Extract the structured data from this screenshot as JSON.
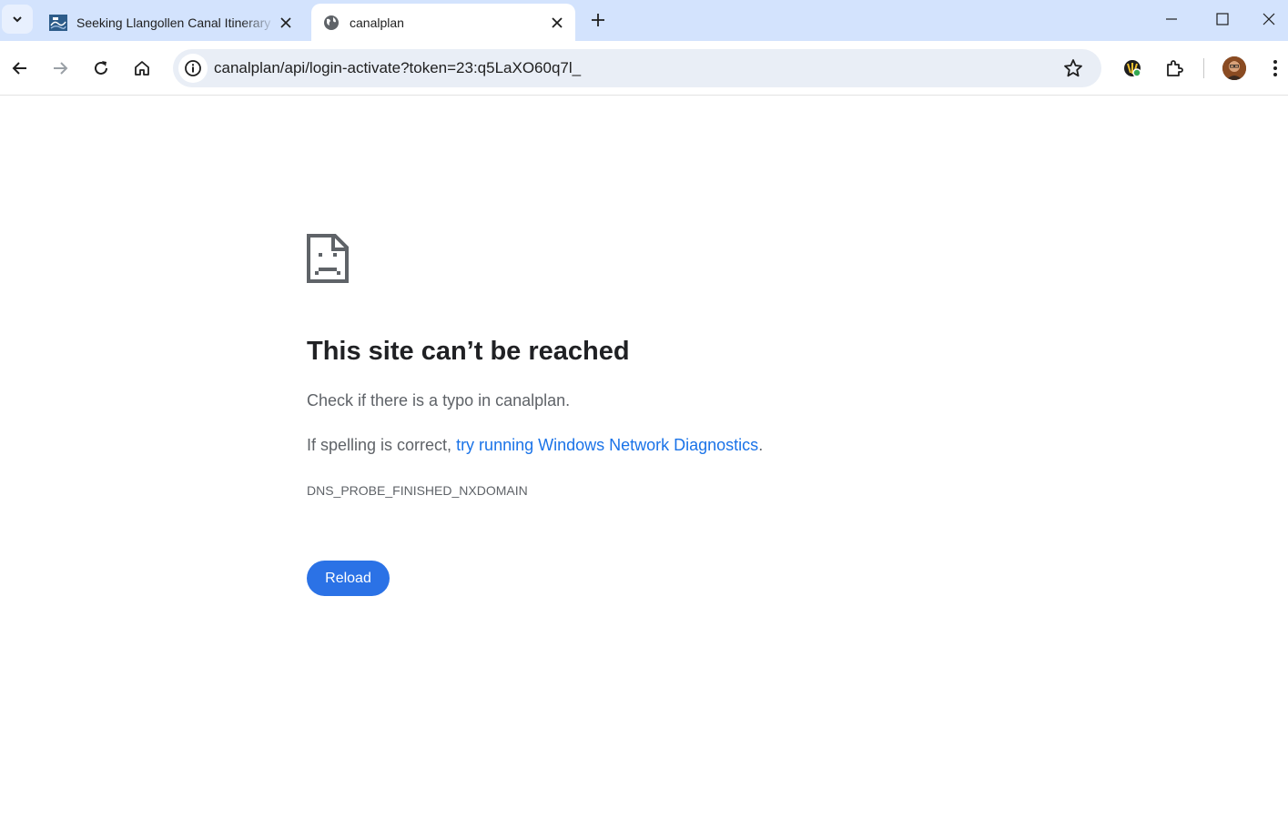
{
  "tabs": [
    {
      "title": "Seeking Llangollen Canal Itinerary",
      "active": false,
      "favicon": "canal-logo-icon"
    },
    {
      "title": "canalplan",
      "active": true,
      "favicon": "globe-icon"
    }
  ],
  "omnibox": {
    "url": "canalplan/api/login-activate?token=23:q5LaXO60q7l_"
  },
  "error": {
    "title": "This site can’t be reached",
    "line1": "Check if there is a typo in canalplan.",
    "line2_prefix": "If spelling is correct, ",
    "line2_link": "try running Windows Network Diagnostics",
    "line2_suffix": ".",
    "code": "DNS_PROBE_FINISHED_NXDOMAIN",
    "reload_label": "Reload"
  },
  "colors": {
    "tabstrip": "#d3e3fd",
    "omnibox": "#e9eef6",
    "link": "#1a73e8",
    "reload_button": "#2b72e6"
  }
}
